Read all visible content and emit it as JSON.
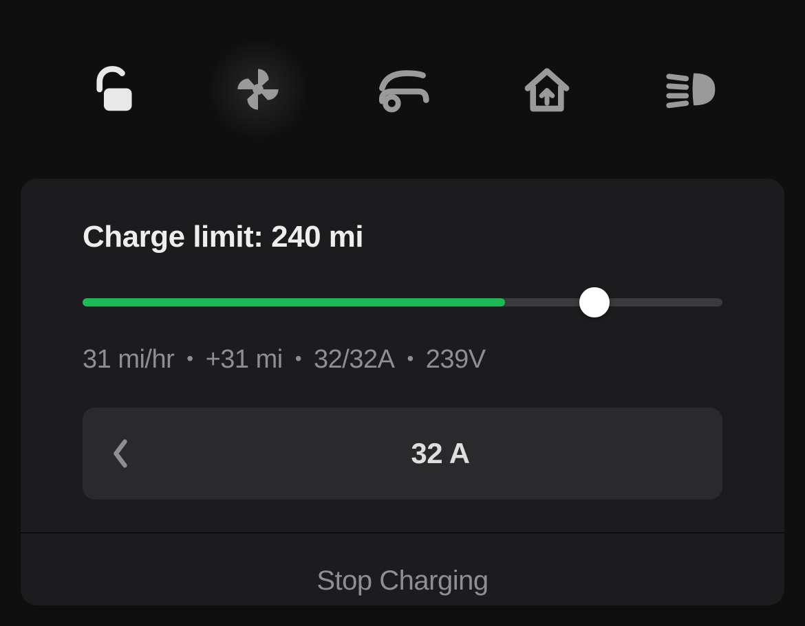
{
  "toolbar": {
    "icons": [
      "lock-icon",
      "fan-icon",
      "frunk-icon",
      "homelink-icon",
      "headlight-icon"
    ]
  },
  "charge_card": {
    "limit_label": "Charge limit: 240 mi",
    "slider": {
      "fill_percent": 66,
      "thumb_percent": 80
    },
    "stats": {
      "rate": "31 mi/hr",
      "added": "+31 mi",
      "amps": "32/32A",
      "volts": "239V"
    },
    "amps_stepper": {
      "value": "32 A"
    },
    "footer_action": "Stop Charging"
  }
}
